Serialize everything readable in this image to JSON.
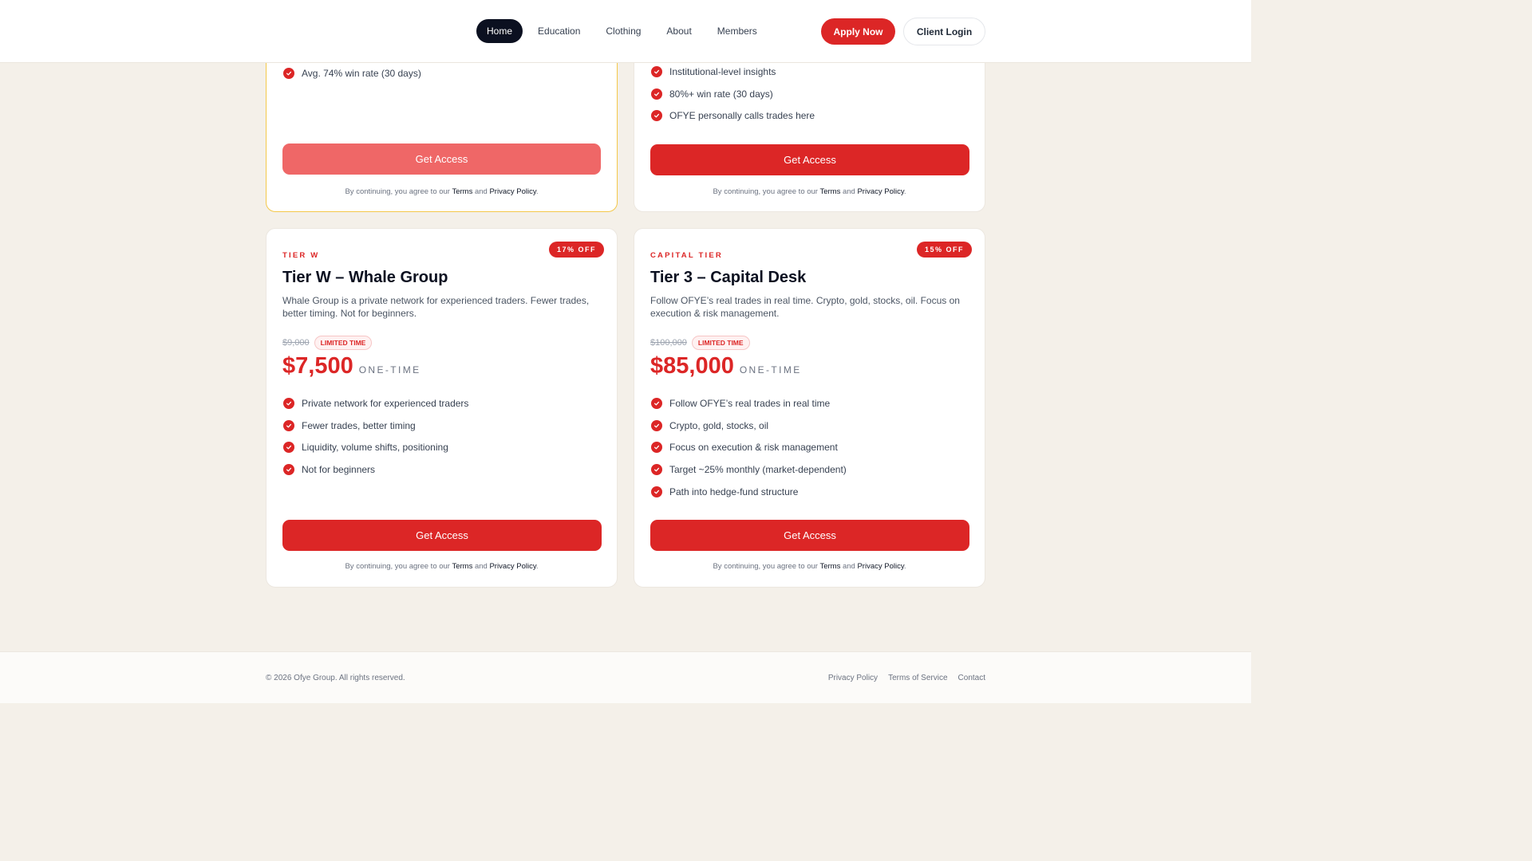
{
  "nav": {
    "items": [
      {
        "label": "Home",
        "active": true
      },
      {
        "label": "Education",
        "active": false
      },
      {
        "label": "Clothing",
        "active": false
      },
      {
        "label": "About",
        "active": false
      },
      {
        "label": "Members",
        "active": false
      }
    ],
    "apply_label": "Apply Now",
    "login_label": "Client Login"
  },
  "top_left_card": {
    "features": [
      "Avg. 74% win rate (30 days)"
    ],
    "cta_label": "Get Access",
    "legal": {
      "prefix": "By continuing, you agree to our",
      "terms": "Terms",
      "and": "and",
      "privacy": "Privacy Policy",
      "suffix": "."
    }
  },
  "top_right_card": {
    "features": [
      "Institutional-level insights",
      "80%+ win rate (30 days)",
      "OFYE personally calls trades here"
    ],
    "cta_label": "Get Access",
    "legal": {
      "prefix": "By continuing, you agree to our",
      "terms": "Terms",
      "and": "and",
      "privacy": "Privacy Policy",
      "suffix": "."
    }
  },
  "whale_card": {
    "tier_label": "TIER W",
    "discount": "17% OFF",
    "title": "Tier W – Whale Group",
    "description": "Whale Group is a private network for experienced traders. Fewer trades, better timing. Not for beginners.",
    "old_price": "$9,000",
    "limited_label": "LIMITED TIME",
    "price": "$7,500",
    "period": "ONE-TIME",
    "features": [
      "Private network for experienced traders",
      "Fewer trades, better timing",
      "Liquidity, volume shifts, positioning",
      "Not for beginners"
    ],
    "cta_label": "Get Access",
    "legal": {
      "prefix": "By continuing, you agree to our",
      "terms": "Terms",
      "and": "and",
      "privacy": "Privacy Policy",
      "suffix": "."
    }
  },
  "capital_card": {
    "tier_label": "CAPITAL TIER",
    "discount": "15% OFF",
    "title": "Tier 3 – Capital Desk",
    "description": "Follow OFYE’s real trades in real time. Crypto, gold, stocks, oil. Focus on execution & risk management.",
    "old_price": "$100,000",
    "limited_label": "LIMITED TIME",
    "price": "$85,000",
    "period": "ONE-TIME",
    "features": [
      "Follow OFYE’s real trades in real time",
      "Crypto, gold, stocks, oil",
      "Focus on execution & risk management",
      "Target ~25% monthly (market-dependent)",
      "Path into hedge-fund structure"
    ],
    "cta_label": "Get Access",
    "legal": {
      "prefix": "By continuing, you agree to our",
      "terms": "Terms",
      "and": "and",
      "privacy": "Privacy Policy",
      "suffix": "."
    }
  },
  "footer": {
    "copyright": "© 2026 Ofye Group. All rights reserved.",
    "links": [
      "Privacy Policy",
      "Terms of Service",
      "Contact"
    ]
  },
  "colors": {
    "accent": "#dc2626",
    "featured_border": "#f4c84a",
    "nav_active": "#0b1020",
    "page_bg": "#f4f0e9"
  }
}
